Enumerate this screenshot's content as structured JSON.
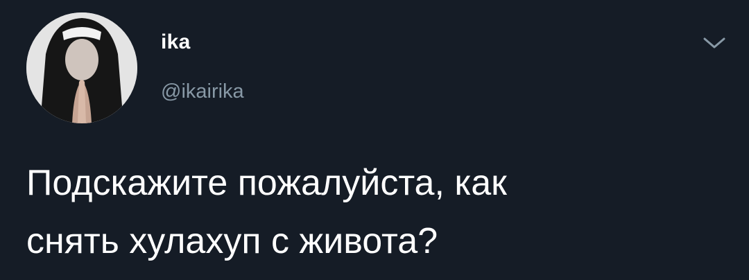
{
  "colors": {
    "background": "#151c26",
    "text_primary": "#ffffff",
    "text_secondary": "#8899a6"
  },
  "tweet": {
    "author": {
      "display_name": "ika",
      "handle": "@ikairika",
      "avatar_icon": "avatar-photo"
    },
    "menu_icon": "chevron-down-icon",
    "text_lines": [
      "Подскажите пожалуйста, как",
      "снять хулахуп с живота?"
    ]
  }
}
